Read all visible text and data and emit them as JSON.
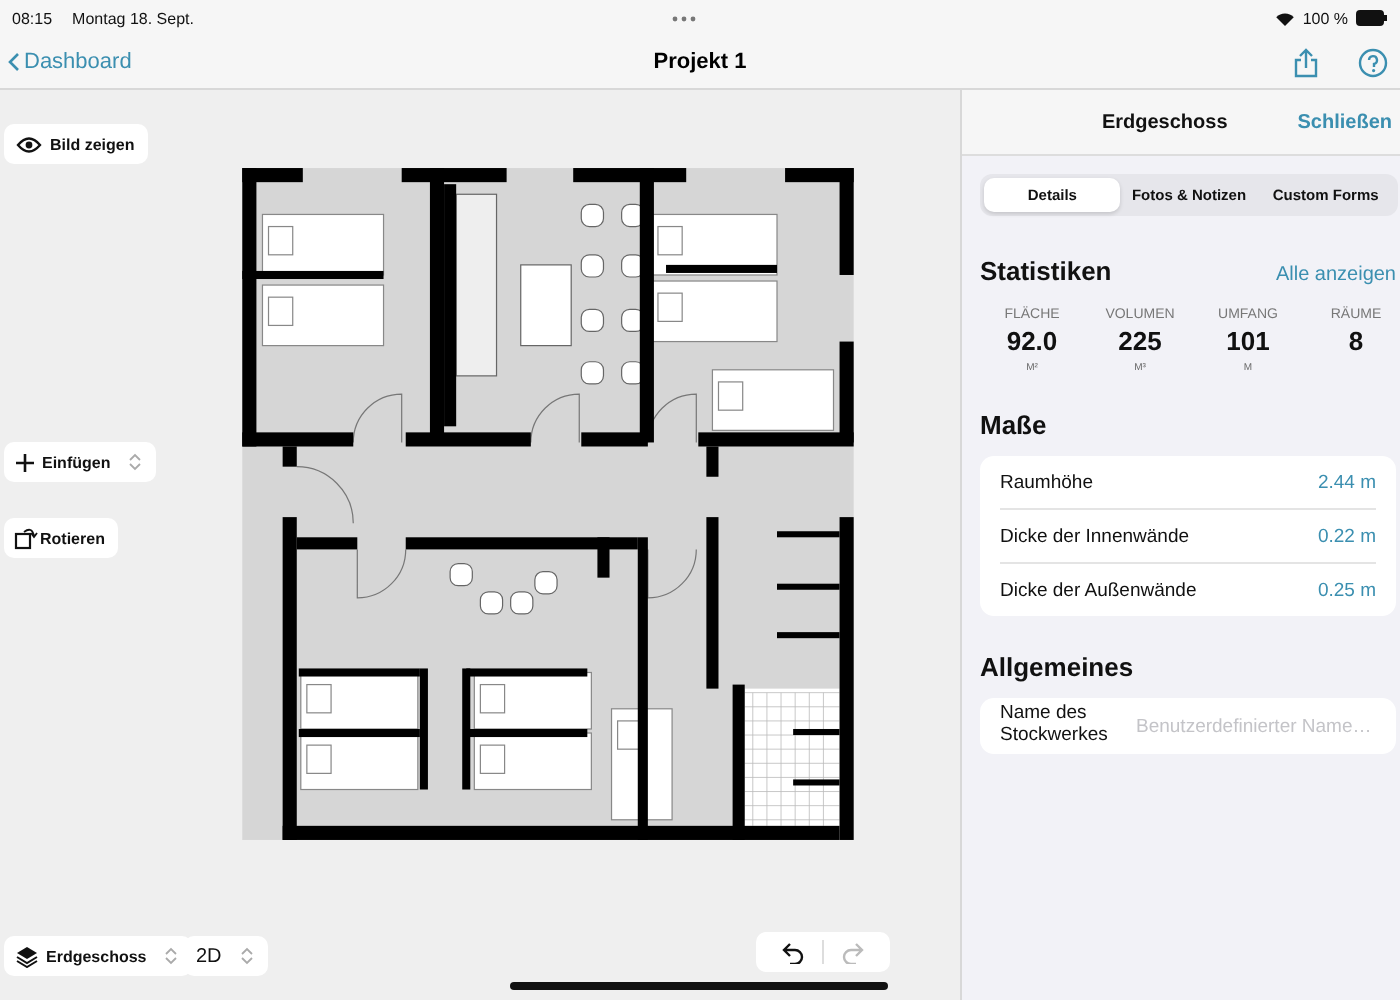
{
  "status_bar": {
    "time": "08:15",
    "date": "Montag 18. Sept.",
    "battery": "100 %"
  },
  "nav_bar": {
    "back": "Dashboard",
    "title": "Projekt 1"
  },
  "canvas": {
    "show_image_button": "Bild zeigen",
    "insert_menu": "Einfügen",
    "rotate_button": "Rotieren",
    "floor_picker": "Erdgeschoss",
    "view_picker": "2D",
    "undo_disabled": false,
    "redo_disabled": true
  },
  "panel": {
    "title": "Erdgeschoss",
    "close": "Schließen",
    "tabs": [
      {
        "label": "Details",
        "selected": true
      },
      {
        "label": "Fotos & Notizen",
        "selected": false
      },
      {
        "label": "Custom Forms",
        "selected": false
      }
    ],
    "statistics": {
      "title": "Statistiken",
      "link": "Alle anzeigen",
      "items": [
        {
          "label": "FLÄCHE",
          "value": "92.0",
          "unit": "M²"
        },
        {
          "label": "VOLUMEN",
          "value": "225",
          "unit": "M³"
        },
        {
          "label": "UMFANG",
          "value": "101",
          "unit": "M"
        },
        {
          "label": "RÄUME",
          "value": "8"
        }
      ]
    },
    "measures": {
      "title": "Maße",
      "rows": [
        {
          "label": "Raumhöhe",
          "value": "2.44 m"
        },
        {
          "label": "Dicke der Innenwände",
          "value": "0.22 m"
        },
        {
          "label": "Dicke der Außenwände",
          "value": "0.25 m"
        }
      ]
    },
    "general": {
      "title": "Allgemeines",
      "field_label": "Name des Stockwerkes",
      "placeholder": "Benutzerdefinierter Name…"
    }
  }
}
